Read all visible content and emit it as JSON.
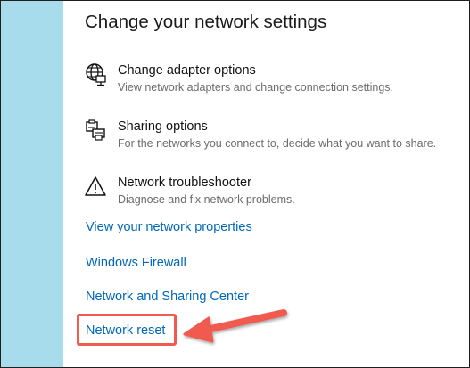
{
  "page": {
    "title": "Change your network settings"
  },
  "options": [
    {
      "title": "Change adapter options",
      "description": "View network adapters and change connection settings.",
      "icon": "globe-adapter-icon"
    },
    {
      "title": "Sharing options",
      "description": "For the networks you connect to, decide what you want to share.",
      "icon": "sharing-printer-icon"
    },
    {
      "title": "Network troubleshooter",
      "description": "Diagnose and fix network problems.",
      "icon": "warning-triangle-icon"
    }
  ],
  "links": {
    "network_properties": "View your network properties",
    "windows_firewall": "Windows Firewall",
    "sharing_center": "Network and Sharing Center",
    "network_reset": "Network reset"
  },
  "colors": {
    "left_strip": "#a7dcec",
    "link": "#0067b8",
    "annotation": "#f05a4f"
  }
}
